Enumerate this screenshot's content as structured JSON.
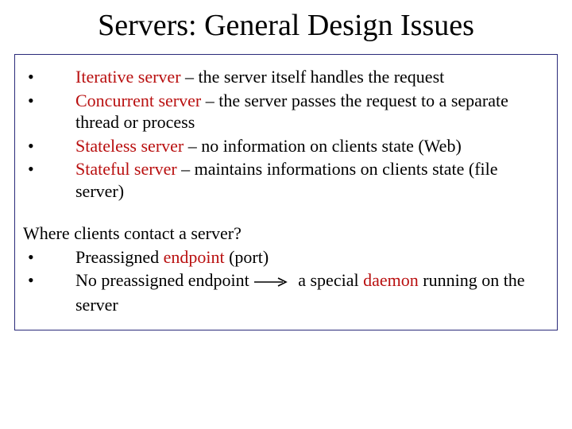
{
  "title": "Servers: General Design Issues",
  "bullets": [
    {
      "term": "Iterative server",
      "rest": " – the server itself handles the request"
    },
    {
      "term": "Concurrent server",
      "rest": " – the server passes the request to a separate thread or process"
    },
    {
      "term": "Stateless server",
      "rest": " – no information on clients state (Web)"
    },
    {
      "term": "Stateful server",
      "rest": " – maintains informations on clients state (file server)"
    }
  ],
  "question": "Where clients contact a server?",
  "q_bullets": [
    {
      "pre": "Preassigned ",
      "term": "endpoint",
      "post": " (port)"
    },
    {
      "pre": "No preassigned endpoint",
      "arrow_then": "a special ",
      "term": "daemon",
      "post": " running on the server"
    }
  ],
  "bullet_char": "•"
}
